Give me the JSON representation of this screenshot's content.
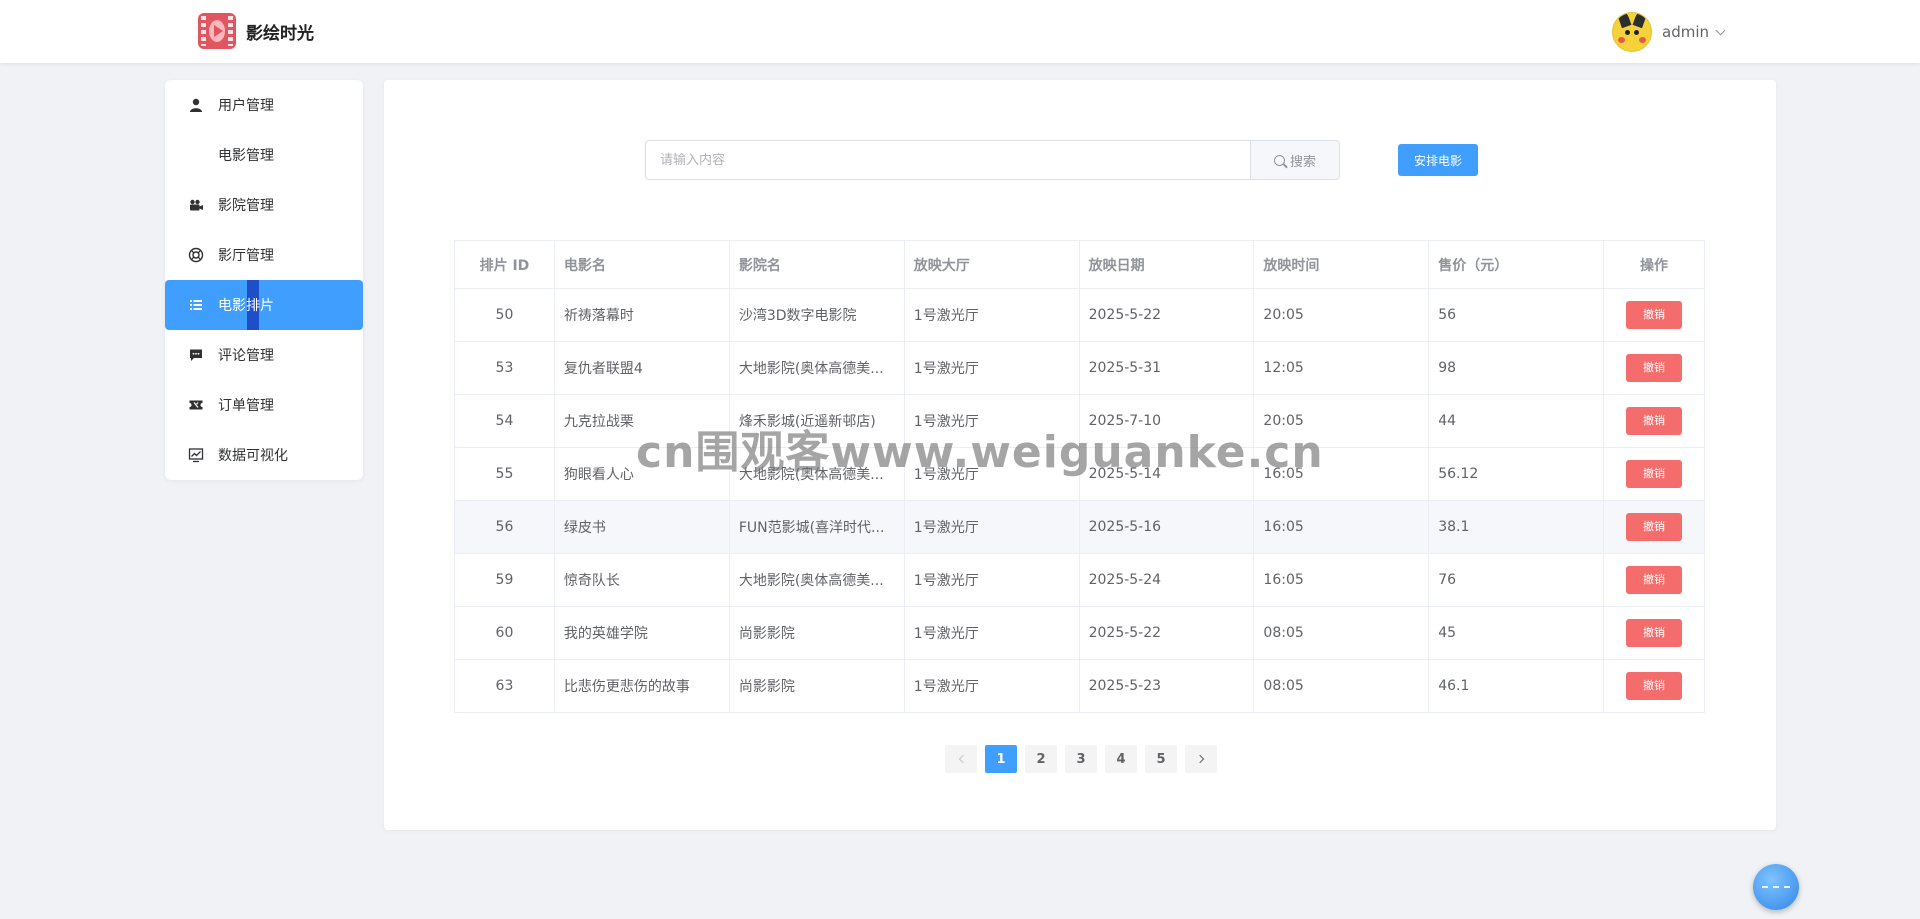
{
  "app": {
    "title": "影绘时光"
  },
  "user": {
    "name": "admin"
  },
  "sidebar": {
    "items": [
      {
        "label": "用户管理",
        "icon": "user-icon"
      },
      {
        "label": "电影管理",
        "icon": ""
      },
      {
        "label": "影院管理",
        "icon": "camera-icon"
      },
      {
        "label": "影厅管理",
        "icon": "ring-icon"
      },
      {
        "label": "电影排片",
        "icon": "list-icon",
        "active": true
      },
      {
        "label": "评论管理",
        "icon": "comment-icon"
      },
      {
        "label": "订单管理",
        "icon": "ticket-icon"
      },
      {
        "label": "数据可视化",
        "icon": "chart-icon"
      }
    ]
  },
  "search": {
    "placeholder": "请输入内容",
    "value": "",
    "button_label": "搜索"
  },
  "actions": {
    "arrange_label": "安排电影"
  },
  "table": {
    "headers": [
      "排片 ID",
      "电影名",
      "影院名",
      "放映大厅",
      "放映日期",
      "放映时间",
      "售价（元）",
      "操作"
    ],
    "rows": [
      [
        "50",
        "祈祷落幕时",
        "沙湾3D数字电影院",
        "1号激光厅",
        "2025-5-22",
        "20:05",
        "56",
        "撤销"
      ],
      [
        "53",
        "复仇者联盟4",
        "大地影院(奥体高德美...",
        "1号激光厅",
        "2025-5-31",
        "12:05",
        "98",
        "撤销"
      ],
      [
        "54",
        "九克拉战栗",
        "烽禾影城(近遥新邨店)",
        "1号激光厅",
        "2025-7-10",
        "20:05",
        "44",
        "撤销"
      ],
      [
        "55",
        "狗眼看人心",
        "大地影院(奥体高德美...",
        "1号激光厅",
        "2025-5-14",
        "16:05",
        "56.12",
        "撤销"
      ],
      [
        "56",
        "绿皮书",
        "FUN范影城(喜洋时代...",
        "1号激光厅",
        "2025-5-16",
        "16:05",
        "38.1",
        "撤销"
      ],
      [
        "59",
        "惊奇队长",
        "大地影院(奥体高德美...",
        "1号激光厅",
        "2025-5-24",
        "16:05",
        "76",
        "撤销"
      ],
      [
        "60",
        "我的英雄学院",
        "尚影影院",
        "1号激光厅",
        "2025-5-22",
        "08:05",
        "45",
        "撤销"
      ],
      [
        "63",
        "比悲伤更悲伤的故事",
        "尚影影院",
        "1号激光厅",
        "2025-5-23",
        "08:05",
        "46.1",
        "撤销"
      ]
    ]
  },
  "pagination": {
    "pages": [
      "1",
      "2",
      "3",
      "4",
      "5"
    ],
    "current": "1"
  },
  "watermark": {
    "text": "cn围观客www.weiguanke.cn"
  },
  "colors": {
    "primary": "#409eff",
    "danger": "#f56c6c",
    "logo": "#e0555f",
    "background": "#f0f2f5"
  }
}
